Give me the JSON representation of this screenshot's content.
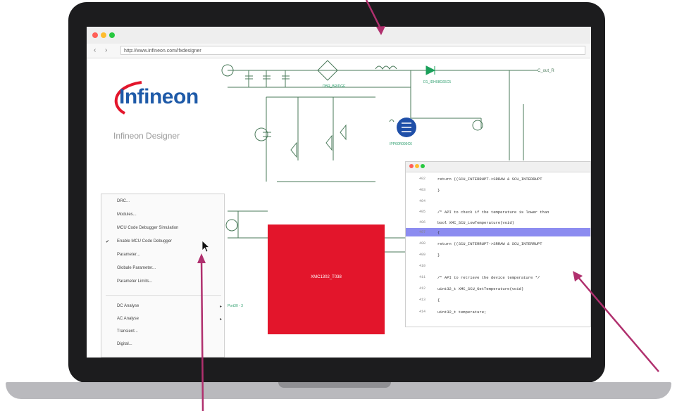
{
  "browser": {
    "url": "http://www.infineon.com/ifxdesigner",
    "back": "‹",
    "forward": "›",
    "traffic_colors": [
      "#ff5f57",
      "#febc2e",
      "#28c840"
    ]
  },
  "brand": {
    "logo_text": "Infineon",
    "app_name": "Infineon Designer",
    "logo_blue": "#1e5aa8",
    "logo_red": "#e3152b"
  },
  "context_menu": {
    "items": [
      {
        "label": "DRC...",
        "checked": false,
        "submenu": false
      },
      {
        "label": "Modules...",
        "checked": false,
        "submenu": false
      },
      {
        "label": "MCU Code Debugger Simulation",
        "checked": false,
        "submenu": false
      },
      {
        "label": "Enable MCU Code Debugger",
        "checked": true,
        "submenu": false
      },
      {
        "label": "Parameter...",
        "checked": false,
        "submenu": false
      },
      {
        "label": "Globale Parameter...",
        "checked": false,
        "submenu": false
      },
      {
        "label": "Parameter Limits...",
        "checked": false,
        "submenu": false
      }
    ],
    "analysis_items": [
      {
        "label": "DC Analyse",
        "submenu": true
      },
      {
        "label": "AC Analyse",
        "submenu": true
      },
      {
        "label": "Transient...",
        "submenu": false
      },
      {
        "label": "Digital...",
        "submenu": false
      }
    ]
  },
  "schematic": {
    "chip_label": "XMC1302_T038",
    "labels": {
      "net_out": "C_out_R",
      "bridge": "DBR_BRIDGE",
      "diode": "D1_IDH08G65C5",
      "mosfet": "IPP60R099C6",
      "input": "Port30 - 3"
    },
    "chip_color": "#e3152b",
    "wire_color": "#4a7a5a",
    "label_color": "#2e9e6e",
    "diode_color": "#1aa05a",
    "mosfet_color": "#1f4fa8"
  },
  "code_editor": {
    "lines": [
      {
        "num": "402",
        "text": "return ((SCU_INTERRUPT->SRRAW & SCU_INTERRUPT",
        "highlight": false
      },
      {
        "num": "403",
        "text": "}",
        "highlight": false
      },
      {
        "num": "404",
        "text": "",
        "highlight": false
      },
      {
        "num": "405",
        "text": "/* API to check if the temperature is lower than",
        "highlight": false
      },
      {
        "num": "406",
        "text": "bool XMC_SCU_LowTemperature(void)",
        "highlight": false
      },
      {
        "num": "407",
        "text": "{",
        "highlight": true
      },
      {
        "num": "408",
        "text": "return ((SCU_INTERRUPT->SRRAW & SCU_INTERRUPT",
        "highlight": false
      },
      {
        "num": "409",
        "text": "}",
        "highlight": false
      },
      {
        "num": "410",
        "text": "",
        "highlight": false
      },
      {
        "num": "411",
        "text": "/* API to retrieve the device temperature */",
        "highlight": false
      },
      {
        "num": "412",
        "text": "uint32_t XMC_SCU_GetTemperature(void)",
        "highlight": false
      },
      {
        "num": "413",
        "text": "{",
        "highlight": false
      },
      {
        "num": "414",
        "text": "uint32_t temperature;",
        "highlight": false
      }
    ],
    "highlight_color": "#8c8cf0"
  },
  "callout_color": "#b0306e"
}
